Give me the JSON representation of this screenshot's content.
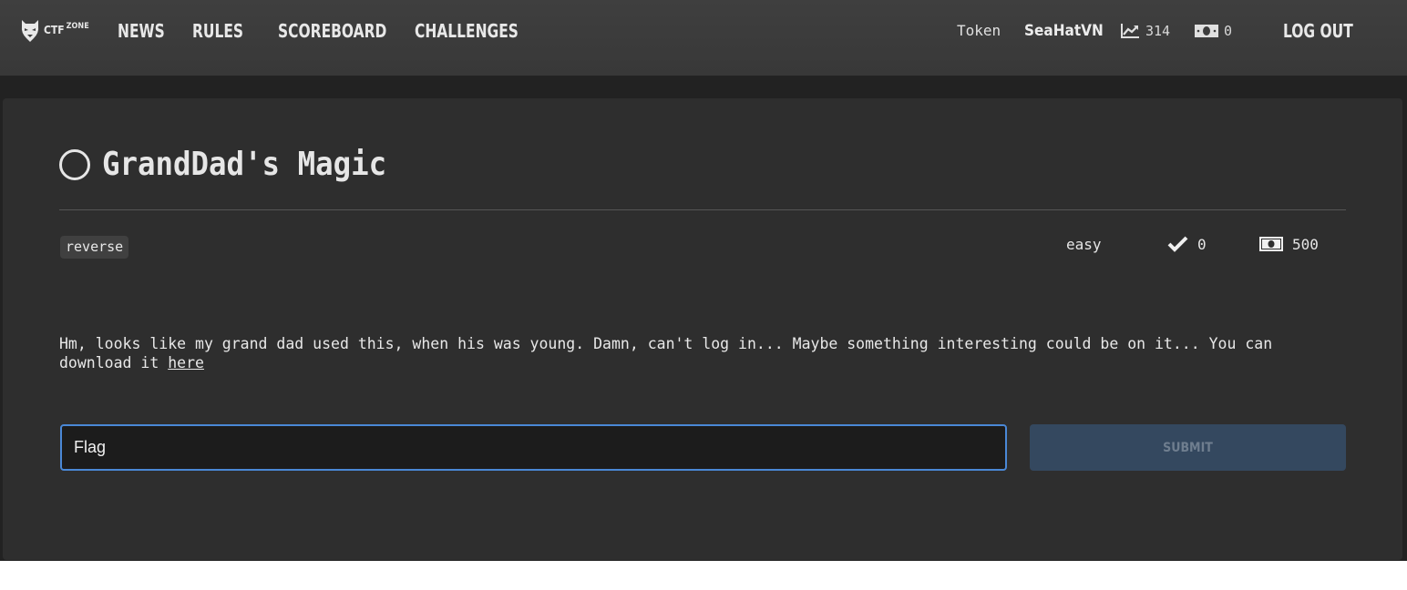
{
  "header": {
    "logo_text": "CTF",
    "logo_sup": "ZONE",
    "nav": [
      {
        "label": "NEWS"
      },
      {
        "label": "RULES"
      },
      {
        "label": "SCOREBOARD"
      },
      {
        "label": "CHALLENGES"
      }
    ],
    "token_label": "Token",
    "username": "SeaHatVN",
    "score": "314",
    "money": "0",
    "logout_label": "LOG OUT"
  },
  "challenge": {
    "title": "GrandDad's Magic",
    "category_tag": "reverse",
    "difficulty": "easy",
    "solves": "0",
    "reward": "500",
    "description": "Hm, looks like my grand dad used this, when his was young. Damn, can't log in... Maybe something interesting could be on it... You can download it",
    "link_label": "here",
    "flag_placeholder": "Flag",
    "submit_label": "SUBMIT"
  },
  "colors": {
    "header_bg": "#3c3c3c",
    "card_bg": "#2e2e2e",
    "input_border": "#4a88d6",
    "submit_bg": "#34485f"
  },
  "icons": {
    "logo": "demon-mask-icon",
    "score": "trending-chart-icon",
    "money": "banknote-icon",
    "solves": "check-icon",
    "reward": "banknote-icon",
    "status": "circle-outline-icon"
  }
}
